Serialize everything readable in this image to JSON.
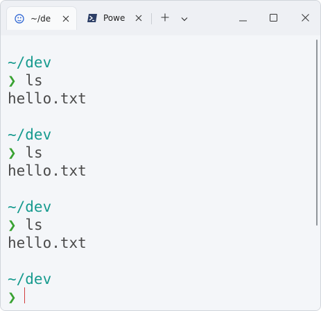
{
  "tabs": [
    {
      "label": "~/de",
      "icon": "linux-penguin-icon",
      "active": true,
      "close_icon": "close-icon"
    },
    {
      "label": "Powe",
      "icon": "powershell-icon",
      "active": false,
      "close_icon": "close-icon"
    }
  ],
  "toolbar": {
    "new_tab_icon": "plus-icon",
    "dropdown_icon": "chevron-down-icon"
  },
  "window_controls": {
    "minimize_icon": "minimize-icon",
    "maximize_icon": "maximize-icon",
    "close_icon": "close-icon"
  },
  "terminal": {
    "blocks": [
      {
        "cwd": "~/dev",
        "prompt": "❯",
        "command": "ls",
        "output": "hello.txt"
      },
      {
        "cwd": "~/dev",
        "prompt": "❯",
        "command": "ls",
        "output": "hello.txt"
      },
      {
        "cwd": "~/dev",
        "prompt": "❯",
        "command": "ls",
        "output": "hello.txt"
      },
      {
        "cwd": "~/dev",
        "prompt": "❯",
        "command": "",
        "output": ""
      }
    ]
  },
  "colors": {
    "cwd": "#169a8e",
    "prompt": "#39a232",
    "text": "#4a4a4a",
    "cursor": "#d23b3b",
    "background": "#f4f6f9"
  }
}
